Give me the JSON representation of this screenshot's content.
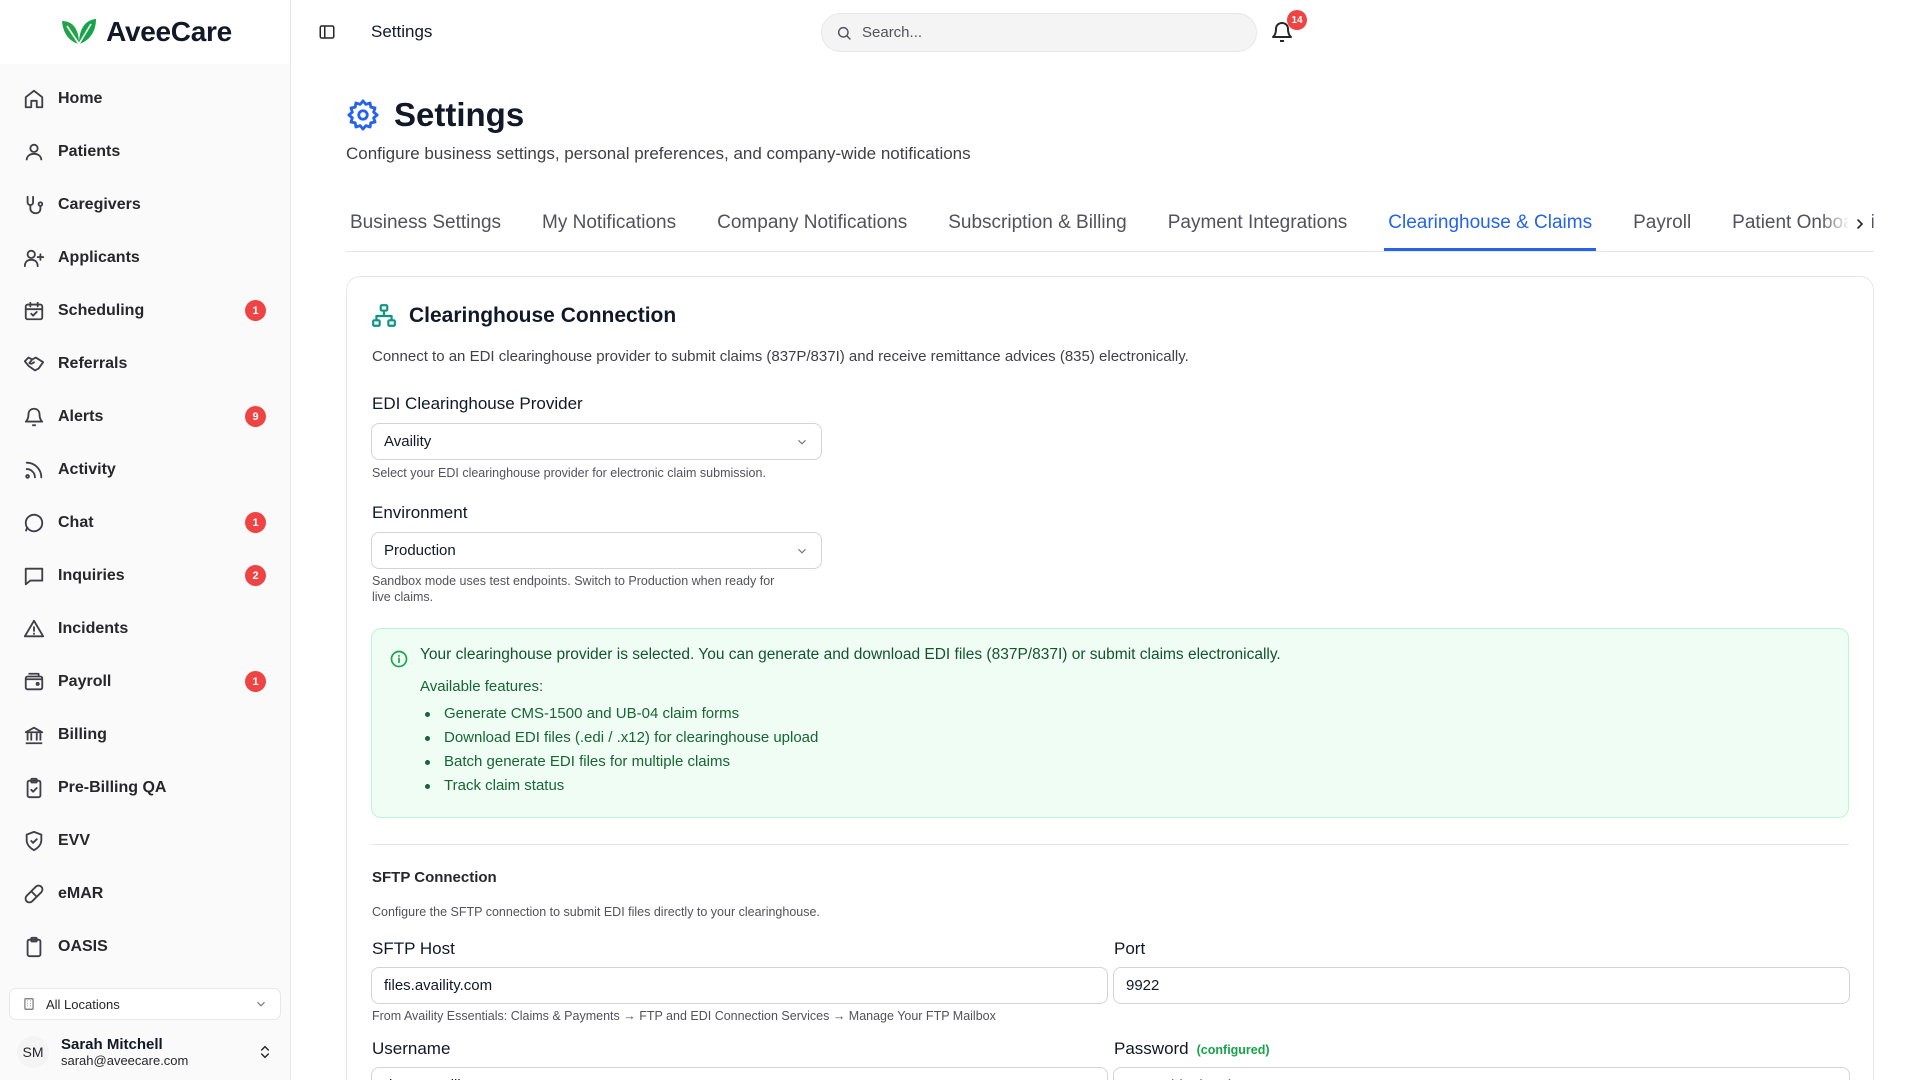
{
  "brand": {
    "name": "AveeCare",
    "color": "#22a34a"
  },
  "sidebar": {
    "items": [
      {
        "label": "Home",
        "icon": "home-icon",
        "badge": ""
      },
      {
        "label": "Patients",
        "icon": "user-icon",
        "badge": ""
      },
      {
        "label": "Caregivers",
        "icon": "stethoscope-icon",
        "badge": ""
      },
      {
        "label": "Applicants",
        "icon": "user-plus-icon",
        "badge": ""
      },
      {
        "label": "Scheduling",
        "icon": "calendar-check-icon",
        "badge": "1"
      },
      {
        "label": "Referrals",
        "icon": "handshake-icon",
        "badge": ""
      },
      {
        "label": "Alerts",
        "icon": "bell-icon",
        "badge": "9"
      },
      {
        "label": "Activity",
        "icon": "rss-icon",
        "badge": ""
      },
      {
        "label": "Chat",
        "icon": "chat-bubble-icon",
        "badge": "1"
      },
      {
        "label": "Inquiries",
        "icon": "message-square-icon",
        "badge": "2"
      },
      {
        "label": "Incidents",
        "icon": "warning-triangle-icon",
        "badge": ""
      },
      {
        "label": "Payroll",
        "icon": "wallet-icon",
        "badge": "1"
      },
      {
        "label": "Billing",
        "icon": "bank-icon",
        "badge": ""
      },
      {
        "label": "Pre-Billing QA",
        "icon": "clipboard-check-icon",
        "badge": ""
      },
      {
        "label": "EVV",
        "icon": "shield-check-icon",
        "badge": ""
      },
      {
        "label": "eMAR",
        "icon": "pill-icon",
        "badge": ""
      },
      {
        "label": "OASIS",
        "icon": "clipboard-list-icon",
        "badge": ""
      }
    ],
    "location": "All Locations",
    "user": {
      "initials": "SM",
      "name": "Sarah Mitchell",
      "email": "sarah@aveecare.com"
    }
  },
  "topbar": {
    "breadcrumb": "Settings",
    "search_placeholder": "Search...",
    "notification_count": "14"
  },
  "page": {
    "title": "Settings",
    "subtitle": "Configure business settings, personal preferences, and company-wide notifications"
  },
  "tabs": [
    {
      "label": "Business Settings",
      "active": false
    },
    {
      "label": "My Notifications",
      "active": false
    },
    {
      "label": "Company Notifications",
      "active": false
    },
    {
      "label": "Subscription & Billing",
      "active": false
    },
    {
      "label": "Payment Integrations",
      "active": false
    },
    {
      "label": "Clearinghouse & Claims",
      "active": true
    },
    {
      "label": "Payroll",
      "active": false
    },
    {
      "label": "Patient Onboarding",
      "active": false
    }
  ],
  "clearinghouse": {
    "title": "Clearinghouse Connection",
    "description": "Connect to an EDI clearinghouse provider to submit claims (837P/837I) and receive remittance advices (835) electronically.",
    "provider_label": "EDI Clearinghouse Provider",
    "provider_value": "Availity",
    "provider_hint": "Select your EDI clearinghouse provider for electronic claim submission.",
    "environment_label": "Environment",
    "environment_value": "Production",
    "environment_hint_1": "Sandbox mode uses test endpoints. Switch to Production when ready for",
    "environment_hint_2": "live claims.",
    "info_main": "Your clearinghouse provider is selected. You can generate and download EDI files (837P/837I) or submit claims electronically.",
    "info_sub": "Available features:",
    "features": [
      "Generate CMS-1500 and UB-04 claim forms",
      "Download EDI files (.edi / .x12) for clearinghouse upload",
      "Batch generate EDI files for multiple claims",
      "Track claim status"
    ],
    "info_color": "#f0fdf4"
  },
  "sftp": {
    "title": "SFTP Connection",
    "description": "Configure the SFTP connection to submit EDI files directly to your clearinghouse.",
    "host_label": "SFTP Host",
    "host_value": "files.availity.com",
    "host_hint": "From Availity Essentials: Claims & Payments → FTP and EDI Connection Services → Manage Your FTP Mailbox",
    "port_label": "Port",
    "port_value": "9922",
    "username_label": "Username",
    "username_value": "demo-availity-user",
    "password_label": "Password",
    "password_status": "(configured)",
    "password_placeholder": "Leave blank to keep current"
  },
  "colors": {
    "accent": "#2563eb",
    "badge": "#ef4444",
    "success": "#16a34a"
  }
}
